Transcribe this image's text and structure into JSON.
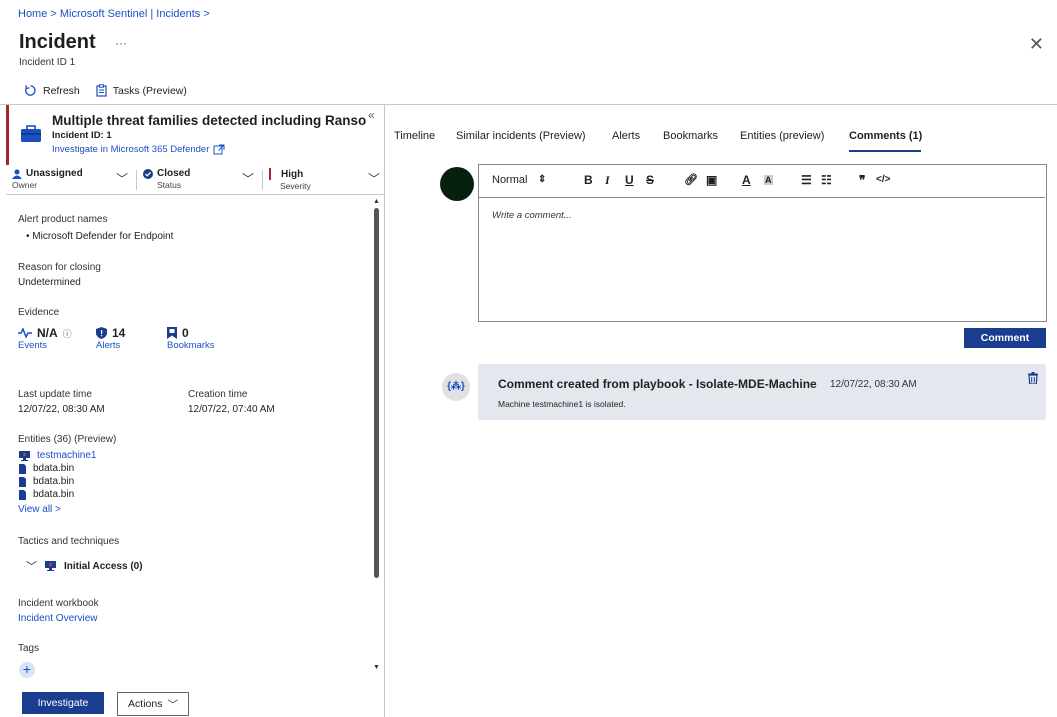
{
  "breadcrumb": "Home  >  Microsoft Sentinel | Incidents  >",
  "header": {
    "title": "Incident",
    "more": "···",
    "subtitle": "Incident ID 1",
    "close": "✕"
  },
  "commands": {
    "refresh": "Refresh",
    "tasks": "Tasks (Preview)"
  },
  "incident": {
    "title": "Multiple threat families detected including Ransomware",
    "collapse": "«",
    "id_label": "Incident ID: 1",
    "investigate_link": "Investigate in Microsoft 365 Defender"
  },
  "status_bar": {
    "owner_value": "Unassigned",
    "owner_label": "Owner",
    "status_value": "Closed",
    "status_label": "Status",
    "severity_value": "High",
    "severity_label": "Severity"
  },
  "details": {
    "alert_products_label": "Alert product names",
    "alert_products": [
      "•  Microsoft Defender for Endpoint"
    ],
    "reason_label": "Reason for closing",
    "reason_value": "Undetermined",
    "evidence_label": "Evidence",
    "events_value": "N/A",
    "events_label": "Events",
    "alerts_value": "14",
    "alerts_label": "Alerts",
    "bookmarks_value": "0",
    "bookmarks_label": "Bookmarks",
    "last_update_label": "Last update time",
    "last_update_value": "12/07/22, 08:30 AM",
    "creation_label": "Creation time",
    "creation_value": "12/07/22, 07:40 AM",
    "entities_label": "Entities (36) (Preview)",
    "entities": [
      {
        "name": "testmachine1",
        "icon": "computer-icon"
      },
      {
        "name": "bdata.bin",
        "icon": "file-icon"
      },
      {
        "name": "bdata.bin",
        "icon": "file-icon"
      },
      {
        "name": "bdata.bin",
        "icon": "file-icon"
      }
    ],
    "view_all": "View all >",
    "tactics_label": "Tactics and techniques",
    "tactic": "Initial Access (0)",
    "workbook_label": "Incident workbook",
    "workbook_link": "Incident Overview",
    "tags_label": "Tags"
  },
  "footer": {
    "investigate": "Investigate",
    "actions": "Actions"
  },
  "tabs": [
    "Timeline",
    "Similar incidents (Preview)",
    "Alerts",
    "Bookmarks",
    "Entities (preview)",
    "Comments (1)"
  ],
  "active_tab": "Comments (1)",
  "editor": {
    "format": "Normal",
    "placeholder": "Write a comment...",
    "submit": "Comment"
  },
  "comment": {
    "title": "Comment created from playbook - Isolate-MDE-Machine",
    "time": "12/07/22, 08:30 AM",
    "body": "Machine testmachine1 is isolated."
  },
  "colors": {
    "accent": "#1b3d8f",
    "severity": "#a4262c",
    "link": "#1a4fc4"
  }
}
